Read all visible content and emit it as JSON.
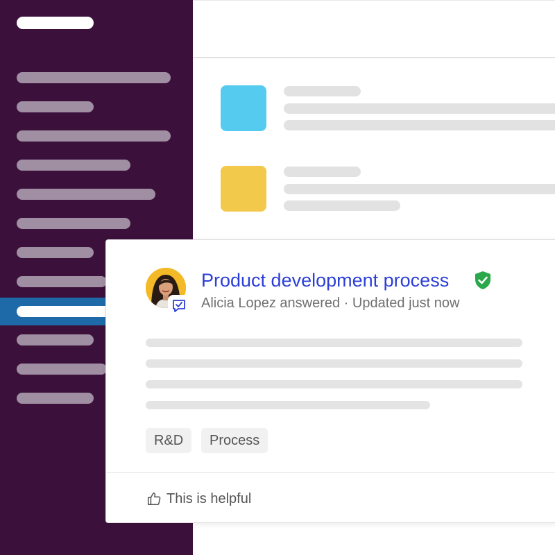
{
  "card": {
    "title": "Product development process",
    "meta": "Alicia Lopez answered · Updated just now",
    "tags": [
      "R&D",
      "Process"
    ],
    "helpful_label": "This is helpful"
  },
  "icons": {
    "verified": "verified-shield-icon",
    "answer_badge": "answer-check-icon",
    "helpful": "thumbs-up-icon"
  },
  "colors": {
    "sidebar": "#3b113b",
    "sidebar_active": "#1e6aa8",
    "title": "#2b3fd6",
    "verified": "#2aa84a",
    "tile_blue": "#56cbf0",
    "tile_yellow": "#f3c94c",
    "avatar_bg": "#f3b927"
  }
}
